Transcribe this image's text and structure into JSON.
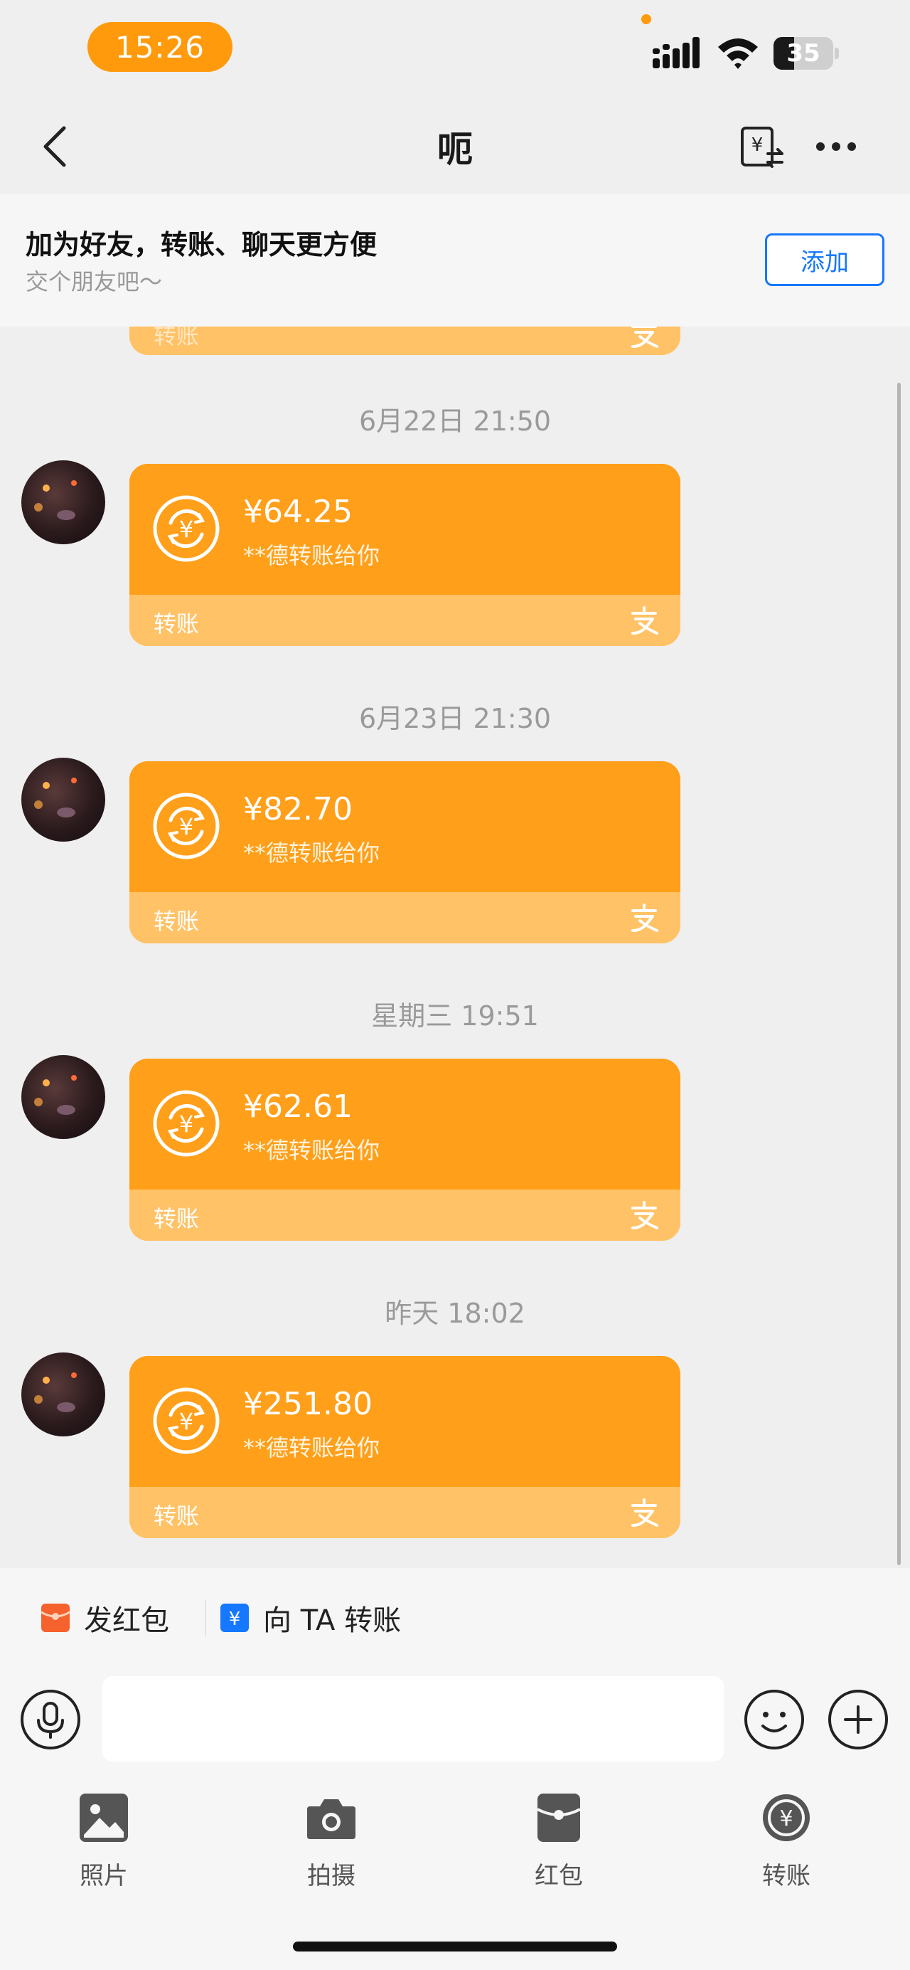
{
  "status_bar": {
    "time": "15:26",
    "battery_level": "35",
    "battery_fraction": 0.35
  },
  "header": {
    "title": "呃"
  },
  "friend_banner": {
    "title": "加为好友，转账、聊天更方便",
    "subtitle": "交个朋友吧～",
    "add_label": "添加"
  },
  "messages": [
    {
      "timestamp": "6月22日 21:50",
      "amount": "¥64.25",
      "description": "**德转账给你",
      "label": "转账"
    },
    {
      "timestamp": "6月23日 21:30",
      "amount": "¥82.70",
      "description": "**德转账给你",
      "label": "转账"
    },
    {
      "timestamp": "星期三 19:51",
      "amount": "¥62.61",
      "description": "**德转账给你",
      "label": "转账"
    },
    {
      "timestamp": "昨天 18:02",
      "amount": "¥251.80",
      "description": "**德转账给你",
      "label": "转账"
    }
  ],
  "partial_card": {
    "label": "转账"
  },
  "quick_actions": {
    "red_packet": "发红包",
    "transfer_to": "向 TA 转账"
  },
  "input": {
    "placeholder": ""
  },
  "toolbar": {
    "photo": "照片",
    "camera": "拍摄",
    "red_packet": "红包",
    "transfer": "转账"
  },
  "colors": {
    "accent": "#ff9f1a",
    "card_bottom": "#ffc266",
    "link": "#1677ff"
  }
}
